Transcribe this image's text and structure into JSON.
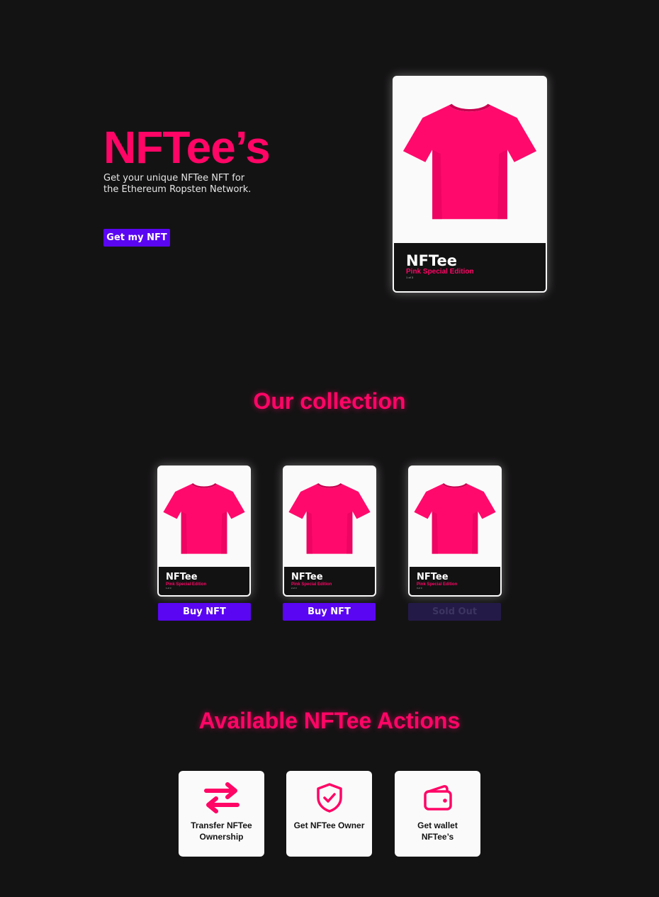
{
  "hero": {
    "title": "NFTee’s",
    "subtitle": "Get your unique NFTee NFT for the Ethereum Ropsten Network.",
    "cta_label": "Get my NFT",
    "card": {
      "name": "NFTee",
      "edition": "Pink Special Edition",
      "count": "1 of 3"
    }
  },
  "collection": {
    "title": "Our collection",
    "items": [
      {
        "name": "NFTee",
        "edition": "Pink Special Edition",
        "count": "1 of 3",
        "button": "Buy NFT",
        "sold_out": false
      },
      {
        "name": "NFTee",
        "edition": "Pink Special Edition",
        "count": "2 of 3",
        "button": "Buy NFT",
        "sold_out": false
      },
      {
        "name": "NFTee",
        "edition": "Pink Special Edition",
        "count": "3 of 3",
        "button": "Sold Out",
        "sold_out": true
      }
    ]
  },
  "actions": {
    "title": "Available NFTee Actions",
    "items": [
      {
        "label": "Transfer NFTee Ownership",
        "icon": "transfer-arrows-icon"
      },
      {
        "label": "Get NFTee Owner",
        "icon": "shield-check-icon"
      },
      {
        "label": "Get wallet NFTee’s",
        "icon": "wallet-icon"
      }
    ]
  },
  "colors": {
    "background": "#141314",
    "accent": "#ff0566",
    "button": "#5a06f2",
    "sold_out_button": "#241a48"
  }
}
